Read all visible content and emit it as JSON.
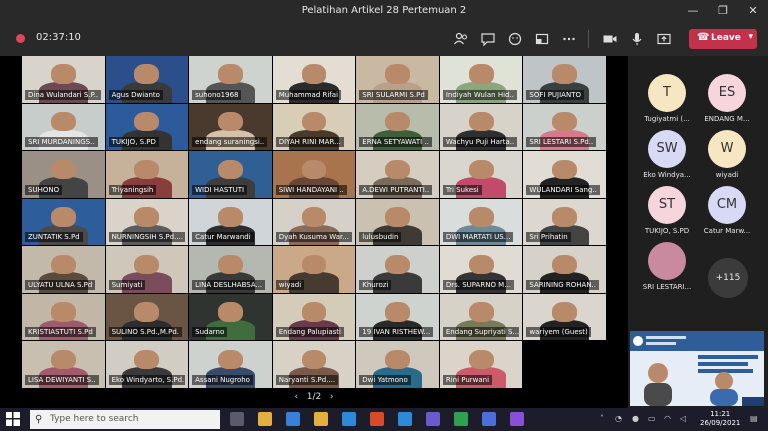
{
  "window": {
    "title": "Pelatihan Artikel 28 Pertemuan 2",
    "minimize": "—",
    "restore": "❐",
    "close": "✕"
  },
  "toolbar": {
    "timer": "02:37:10",
    "leave_label": "Leave",
    "icons": [
      "participants-icon",
      "chat-icon",
      "reactions-icon",
      "rooms-icon",
      "more-icon",
      "camera-icon",
      "mic-icon",
      "share-icon"
    ]
  },
  "grid": {
    "tiles": [
      {
        "name": "Dina Wulandari S.P..",
        "bg": "#d8d4cc",
        "shirt": "#6d4a52"
      },
      {
        "name": "Agus Dwianto",
        "bg": "#2a4f8a",
        "shirt": "#3a3a3a"
      },
      {
        "name": "suhono1968",
        "bg": "#cfd3cf",
        "shirt": "#555"
      },
      {
        "name": "Muhammad Rifai",
        "bg": "#e3ddd3",
        "shirt": "#2b2b2b"
      },
      {
        "name": "SRI SULARMI S.Pd",
        "bg": "#c9b8a2",
        "shirt": "#b9a08a"
      },
      {
        "name": "Indiyah Wulan Hid..",
        "bg": "#dfe2d6",
        "shirt": "#8da57a"
      },
      {
        "name": "SOFI PUJIANTO",
        "bg": "#bfc4c6",
        "shirt": "#39403f"
      },
      {
        "name": "SRI MURDANINGS..",
        "bg": "#c6cdcb",
        "shirt": "#e5e5e5"
      },
      {
        "name": "TUKIJO, S.PD",
        "bg": "#2c5a9a",
        "shirt": "#333"
      },
      {
        "name": "endang suraningsi..",
        "bg": "#4a3a2e",
        "shirt": "#d6c2a6"
      },
      {
        "name": "DIYAH RINI MAR...",
        "bg": "#d8cdb6",
        "shirt": "#4b3a2a"
      },
      {
        "name": "ERNA SETYAWATI ..",
        "bg": "#b7bdaa",
        "shirt": "#3f5e3a"
      },
      {
        "name": "Wachyu Puji Harta..",
        "bg": "#d7d3cb",
        "shirt": "#2f2f2f"
      },
      {
        "name": "SRI LESTARI S.Pd..",
        "bg": "#ccd0cd",
        "shirt": "#d47a8a"
      },
      {
        "name": "SUHONO",
        "bg": "#9a9086",
        "shirt": "#444"
      },
      {
        "name": "Triyaningsih",
        "bg": "#c6b19a",
        "shirt": "#8a3d3d"
      },
      {
        "name": "WIDI HASTUTI",
        "bg": "#2f5f95",
        "shirt": "#3d3d3d"
      },
      {
        "name": "SIWI HANDAYANI ..",
        "bg": "#a8744e",
        "shirt": "#6a4636"
      },
      {
        "name": "A.DEWI PUTRANTI..",
        "bg": "#d5cdbf",
        "shirt": "#7a6a5a"
      },
      {
        "name": "Tri Sukesi",
        "bg": "#d9d6cf",
        "shirt": "#c24a6a"
      },
      {
        "name": "WULANDARI Sang..",
        "bg": "#e1ddd4",
        "shirt": "#232323"
      },
      {
        "name": "ZUNTATIK S.Pd",
        "bg": "#2d5d9a",
        "shirt": "#4a4a4a"
      },
      {
        "name": "NURNINGSIH S.Pd....",
        "bg": "#d9d3c9",
        "shirt": "#5c5c5c"
      },
      {
        "name": "Catur Marwandi",
        "bg": "#cfd5d8",
        "shirt": "#2d2d2d"
      },
      {
        "name": "Dyah Kusuma War...",
        "bg": "#d5d0c8",
        "shirt": "#8c6a5a"
      },
      {
        "name": "lulusbudin",
        "bg": "#cbc1b0",
        "shirt": "#3e3a34"
      },
      {
        "name": "DWI MARTATI US...",
        "bg": "#d9dddc",
        "shirt": "#6b8a9a"
      },
      {
        "name": "Sri Prihatin",
        "bg": "#dcd8d0",
        "shirt": "#444"
      },
      {
        "name": "ULYATU ULNA S.Pd",
        "bg": "#c3b9aa",
        "shirt": "#5a4b3c"
      },
      {
        "name": "Sumiyati",
        "bg": "#cfc7ba",
        "shirt": "#7a4c5c"
      },
      {
        "name": "LINA DESLHABSA...",
        "bg": "#b5b7b1",
        "shirt": "#393939"
      },
      {
        "name": "wiyadi",
        "bg": "#caa989",
        "shirt": "#473a30"
      },
      {
        "name": "Khurozi",
        "bg": "#cdd0cc",
        "shirt": "#3a3a3a"
      },
      {
        "name": "Drs. SUPARNO M...",
        "bg": "#e0dcd4",
        "shirt": "#343434"
      },
      {
        "name": "SARINING ROHAN..",
        "bg": "#d6d1c9",
        "shirt": "#232323"
      },
      {
        "name": "KRISTIASTUTI S.Pd",
        "bg": "#c2b6a6",
        "shirt": "#9c5c6c"
      },
      {
        "name": "SULINO S.Pd.,M.Pd.",
        "bg": "#6a5544",
        "shirt": "#2d2d2d"
      },
      {
        "name": "Sudarno",
        "bg": "#2f3430",
        "shirt": "#3e6e3e"
      },
      {
        "name": "Endang Palupiasti",
        "bg": "#d4cbb9",
        "shirt": "#6a3a4a"
      },
      {
        "name": "19 IVAN RISTHEW...",
        "bg": "#cfd3d0",
        "shirt": "#2a2a2a"
      },
      {
        "name": "Endang Supriyati S...",
        "bg": "#d7d2c8",
        "shirt": "#7a7a5a"
      },
      {
        "name": "wariyem (Guest)",
        "bg": "#dbd6cd",
        "shirt": "#222"
      },
      {
        "name": "LISA DEWIYANTI S..",
        "bg": "#c8bfb1",
        "shirt": "#a45a6a"
      },
      {
        "name": "Eko Windyarto, S.Pd.",
        "bg": "#d2cdc4",
        "shirt": "#3a3a3a"
      },
      {
        "name": "Assani Nugroho",
        "bg": "#cdd2cf",
        "shirt": "#3a4a6a"
      },
      {
        "name": "Naryanti S.Pd....",
        "bg": "#d8d2c6",
        "shirt": "#7a5a4a"
      },
      {
        "name": "Dwi Yatmono",
        "bg": "#cfc8bc",
        "shirt": "#2a6a8a"
      },
      {
        "name": "Rini Purwani",
        "bg": "#dad4ca",
        "shirt": "#cc5a6a"
      }
    ],
    "pager": "1/2"
  },
  "sidebar": {
    "participants": [
      {
        "initials": "T",
        "name": "Tugiyatmi (...",
        "color": "#f6e6c2"
      },
      {
        "initials": "ES",
        "name": "ENDANG M...",
        "color": "#f6d5dc"
      },
      {
        "initials": "SW",
        "name": "Eko Windya...",
        "color": "#d8d9f4"
      },
      {
        "initials": "W",
        "name": "wiyadi",
        "color": "#f6e6c2"
      },
      {
        "initials": "ST",
        "name": "TUKIJO, S.PD",
        "color": "#f6d5dc"
      },
      {
        "initials": "CM",
        "name": "Catur Marw...",
        "color": "#d8d9f4"
      },
      {
        "initials": "",
        "name": "SRI LESTARI...",
        "color": "#c98aa0"
      }
    ],
    "more_label": "+115"
  },
  "taskbar": {
    "search_placeholder": "Type here to search",
    "time": "11:21",
    "date": "26/09/2021",
    "app_colors": [
      "#5a5a6a",
      "#e3b040",
      "#3a7fd8",
      "#e3b040",
      "#2d8ad8",
      "#d84a2a",
      "#2d8ad8",
      "#6a5acd",
      "#30a050",
      "#4a6fd8",
      "#8a4fd8"
    ]
  }
}
